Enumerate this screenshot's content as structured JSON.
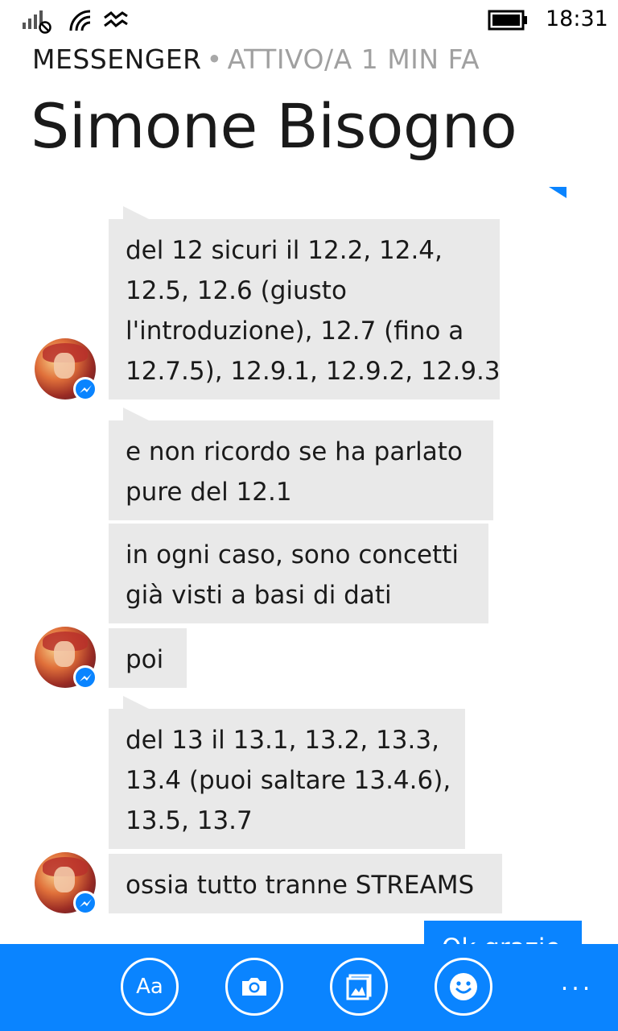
{
  "status_bar": {
    "time": "18:31",
    "icons": [
      "signal-no-sim-icon",
      "wifi-icon",
      "data-icon",
      "battery-icon"
    ]
  },
  "header": {
    "app_name": "MESSENGER",
    "separator": "•",
    "active_status": "ATTIVO/A 1 MIN FA",
    "contact_name": "Simone Bisogno"
  },
  "messages": [
    {
      "lines": [
        "del 12 sicuri il 12.2, 12.4,",
        "12.5, 12.6 (giusto",
        "l'introduzione), 12.7 (fino a",
        "12.7.5), 12.9.1, 12.9.2, 12.9.3"
      ]
    },
    {
      "lines": [
        "e non ricordo se ha parlato",
        "pure del 12.1"
      ]
    },
    {
      "lines": [
        "in ogni caso, sono concetti",
        "già visti a basi di dati"
      ]
    },
    {
      "lines": [
        "poi"
      ]
    },
    {
      "lines": [
        "del 13 il 13.1, 13.2, 13.3,",
        "13.4 (puoi saltare 13.4.6),",
        "13.5, 13.7"
      ]
    },
    {
      "lines": [
        "ossia tutto tranne STREAMS"
      ]
    }
  ],
  "sent_partial": "Ok grazie",
  "app_bar": {
    "font_button_label": "Aa",
    "buttons": [
      "font-icon",
      "camera-icon",
      "photo-icon",
      "emoji-icon"
    ],
    "more_label": "..."
  },
  "colors": {
    "accent": "#0a84ff",
    "bubble_bg": "#e9e9e9",
    "muted_text": "#a0a0a0"
  }
}
